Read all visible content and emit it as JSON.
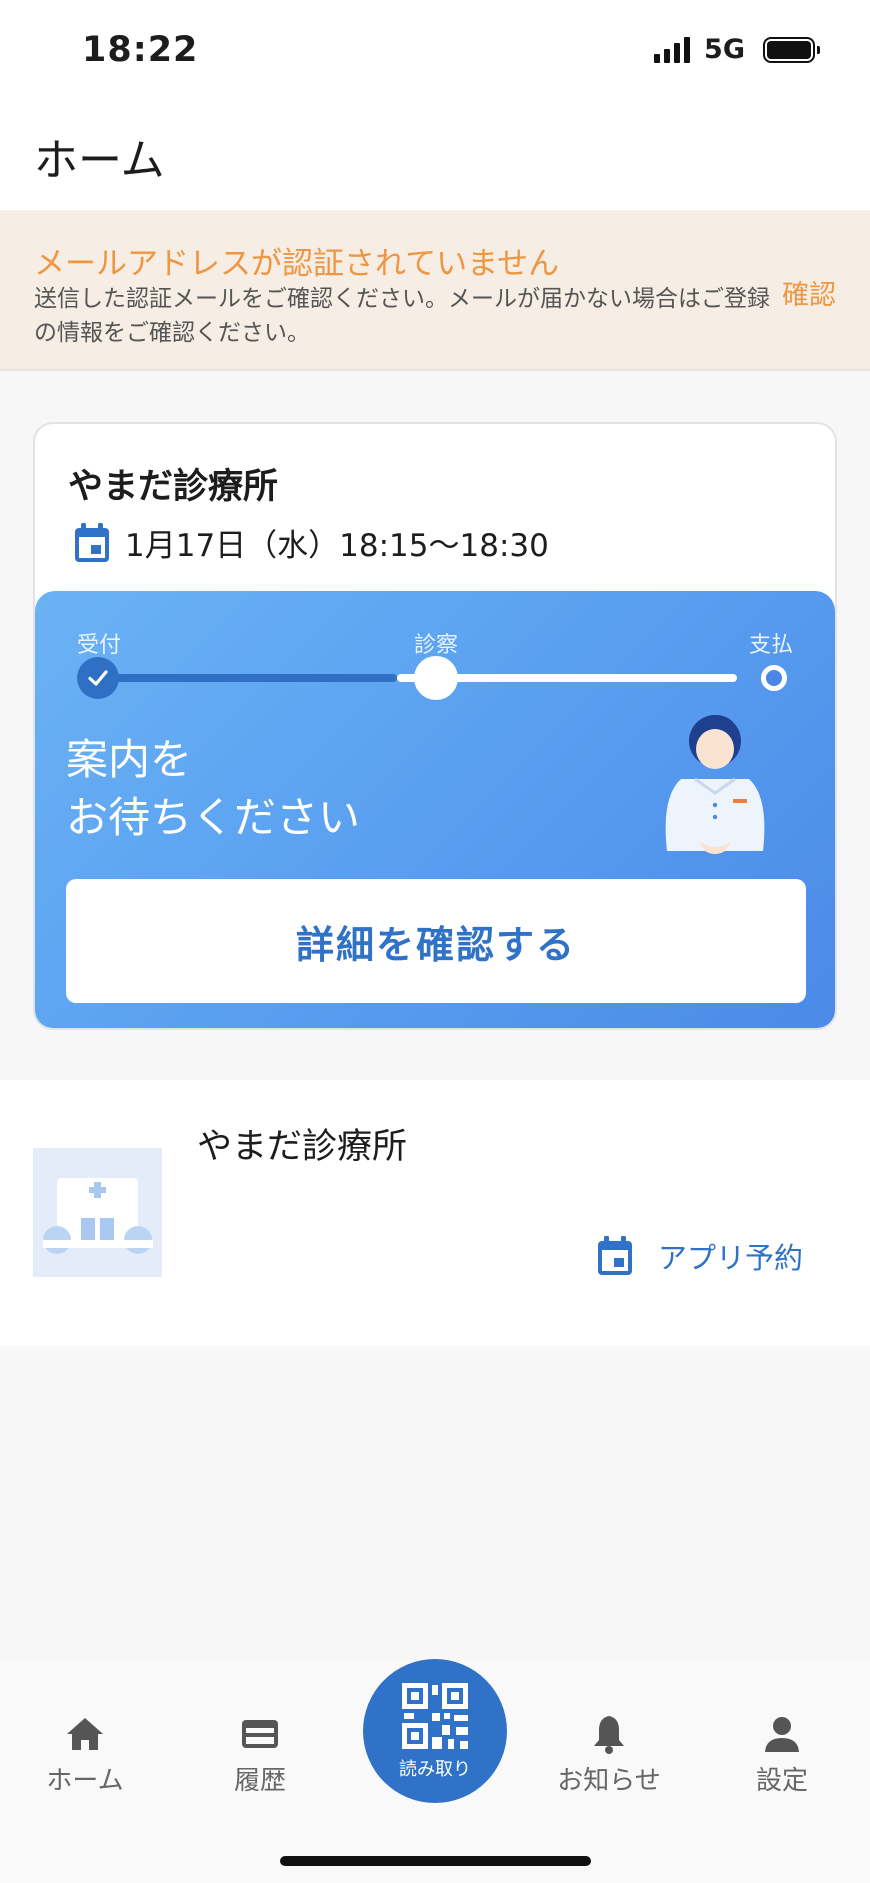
{
  "status_bar": {
    "time": "18:22",
    "network": "5G"
  },
  "header": {
    "title": "ホーム"
  },
  "alert": {
    "title": "メールアドレスが認証されていません",
    "message": "送信した認証メールをご確認ください。メールが届かない場合はご登録の情報をご確認ください。",
    "action_label": "確認",
    "color": "#ee9641"
  },
  "appointment": {
    "clinic_name": "やまだ診療所",
    "date_time": "1月17日（水）18:15〜18:30",
    "steps": [
      {
        "label": "受付",
        "state": "done"
      },
      {
        "label": "診察",
        "state": "current"
      },
      {
        "label": "支払",
        "state": "pending"
      }
    ],
    "status_message": "案内を\nお待ちください",
    "detail_button_label": "詳細を確認する"
  },
  "clinic_card": {
    "name": "やまだ診療所",
    "reserve_label": "アプリ予約",
    "thumb_icon": "hospital-icon"
  },
  "tab_bar": {
    "tabs": [
      {
        "label": "ホーム",
        "icon": "home-icon"
      },
      {
        "label": "履歴",
        "icon": "card-icon"
      },
      {
        "label": "読み取り",
        "icon": "qr-code-icon"
      },
      {
        "label": "お知らせ",
        "icon": "bell-icon"
      },
      {
        "label": "設定",
        "icon": "person-icon"
      }
    ]
  },
  "colors": {
    "accent": "#2f72c7",
    "warning": "#ee9641"
  }
}
